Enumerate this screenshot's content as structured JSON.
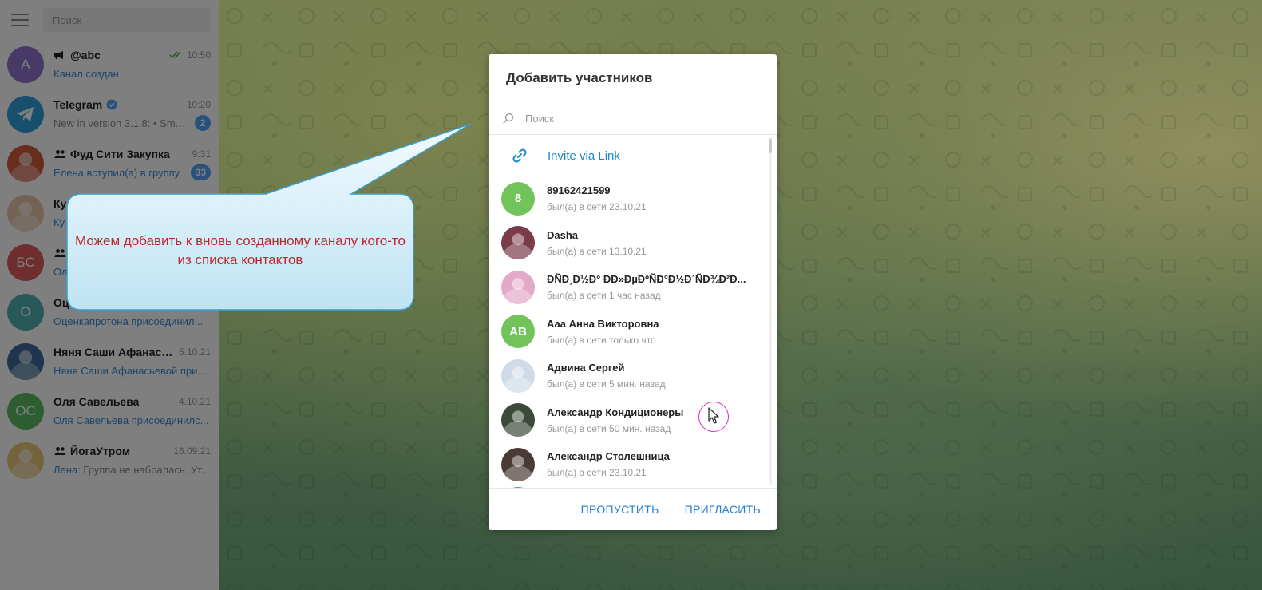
{
  "sidebar": {
    "search_placeholder": "Поиск",
    "chats": [
      {
        "name": "@abc",
        "time": "10:50",
        "preview": "Канал создан",
        "preview_style": "link",
        "avatar_text": "А",
        "avatar_color": "#8e74cc",
        "kind": "channel",
        "read": true
      },
      {
        "name": "Telegram",
        "time": "10:20",
        "preview": "New in version 3.1.8:  • Smal...",
        "preview_style": "gray",
        "avatar_text": "",
        "avatar_color": "#2e9fd9",
        "kind": "telegram",
        "badge": "2"
      },
      {
        "name": "Фуд Сити Закупка",
        "time": "9:31",
        "preview": "Елена вступил(а) в группу",
        "preview_style": "link",
        "avatar_text": "",
        "avatar_color": "#d35a3a",
        "kind": "group",
        "badge": "33"
      },
      {
        "name": "Ку",
        "time": "",
        "preview": "Ку",
        "preview_style": "link",
        "avatar_text": "",
        "avatar_color": "#e7c6a4",
        "kind": "photo"
      },
      {
        "name": "",
        "time": "",
        "preview": "Олі",
        "preview_style": "link",
        "avatar_text": "БС",
        "avatar_color": "#e05b5b",
        "kind": "group"
      },
      {
        "name": "Оц",
        "time": "",
        "preview": "Оценкапротона присоединил...",
        "preview_style": "link",
        "avatar_text": "О",
        "avatar_color": "#4fb3b0",
        "kind": "plain"
      },
      {
        "name": "Няня Саши Афанасье...",
        "time": "5.10.21",
        "preview": "Няня Саши Афанасьевой прис...",
        "preview_style": "link",
        "avatar_text": "",
        "avatar_color": "#3d6b9a",
        "kind": "photo"
      },
      {
        "name": "Оля Савельева",
        "time": "4.10.21",
        "preview": "Оля Савельева присоединилс...",
        "preview_style": "link",
        "avatar_text": "ОС",
        "avatar_color": "#5dbb63",
        "kind": "plain"
      },
      {
        "name": "ЙогаУтром",
        "time": "16.09.21",
        "preview_sender": "Лена:",
        "preview": " Группа не набралась. Ут...",
        "preview_style": "gray",
        "avatar_text": "",
        "avatar_color": "#e9c87a",
        "kind": "group"
      }
    ]
  },
  "modal": {
    "title": "Добавить участников",
    "search_placeholder": "Поиск",
    "invite_label": "Invite via Link",
    "contacts": [
      {
        "name": "89162421599",
        "status": "был(а) в сети 23.10.21",
        "avatar_text": "8",
        "avatar_color": "#72c45a"
      },
      {
        "name": "Dasha",
        "status": "был(а) в сети 13.10.21",
        "avatar_text": "",
        "avatar_color": "#7a3b4a"
      },
      {
        "name": "ÐÑÐ¸Ð½Ð° ÐÐ»ÐµÐºÑÐ°Ð½Ð´ÑÐ¾Ð²Ð...",
        "status": "был(а) в сети 1 час назад",
        "avatar_text": "",
        "avatar_color": "#e3a9c9"
      },
      {
        "name": "Ааа Анна Викторовна",
        "status": "был(а) в сети только что",
        "avatar_text": "АВ",
        "avatar_color": "#72c45a"
      },
      {
        "name": "Адвина Сергей",
        "status": "был(а) в сети 5 мин. назад",
        "avatar_text": "",
        "avatar_color": "#cfdbe6"
      },
      {
        "name": "Александр Кондиционеры",
        "status": "был(а) в сети 50 мин. назад",
        "avatar_text": "",
        "avatar_color": "#3c4a3a"
      },
      {
        "name": "Александр Столешница",
        "status": "был(а) в сети 23.10.21",
        "avatar_text": "",
        "avatar_color": "#4a3a36"
      }
    ],
    "skip_label": "ПРОПУСТИТЬ",
    "invite_button_label": "ПРИГЛАСИТЬ"
  },
  "callout": {
    "text": "Можем добавить к вновь созданному каналу кого-то из списка контактов",
    "text_color": "#c0272d"
  },
  "colors": {
    "accent": "#168acd",
    "link_preview": "#3a8ad6",
    "badge": "#4ea4f6"
  }
}
